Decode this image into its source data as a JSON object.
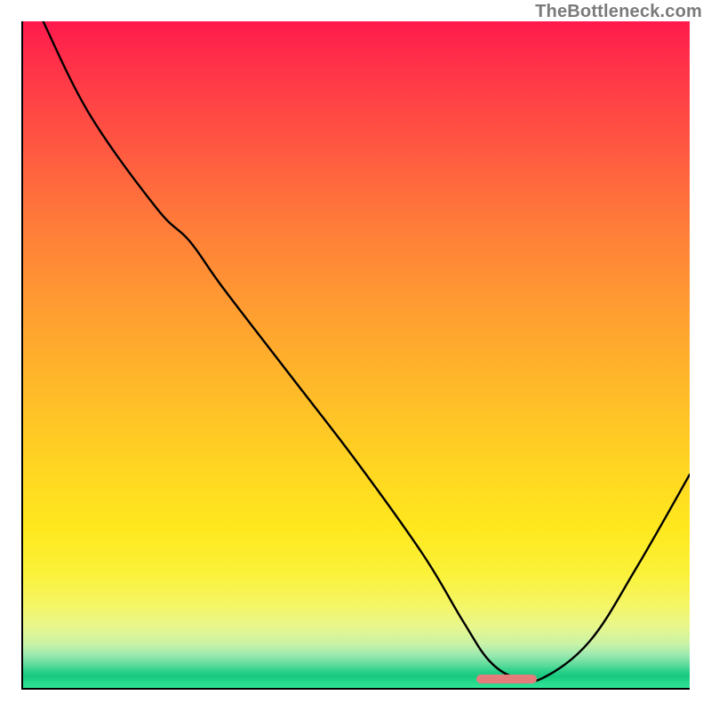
{
  "watermark": "TheBottleneck.com",
  "chart_data": {
    "type": "line",
    "title": "",
    "xlabel": "",
    "ylabel": "",
    "xlim": [
      0,
      100
    ],
    "ylim": [
      0,
      100
    ],
    "grid": false,
    "legend": false,
    "background": "redgradient-to-green-at-bottom",
    "series": [
      {
        "name": "bottleneck-curve",
        "x": [
          3,
          10,
          20,
          25,
          30,
          40,
          50,
          60,
          66,
          70,
          74,
          78,
          85,
          92,
          100
        ],
        "values": [
          100,
          86,
          72,
          67,
          60,
          47,
          34,
          20,
          10,
          4,
          1.5,
          1.5,
          7,
          18,
          32
        ]
      }
    ],
    "annotations": [
      {
        "name": "optimal-range-marker",
        "x_start": 68,
        "x_end": 77,
        "y": 1.3,
        "color": "#e47c7c"
      }
    ],
    "gradient_stops": [
      {
        "pct": 0,
        "color": "#ff1a4d"
      },
      {
        "pct": 50,
        "color": "#ffb020"
      },
      {
        "pct": 85,
        "color": "#fff22a"
      },
      {
        "pct": 100,
        "color": "#2ee396"
      }
    ]
  }
}
